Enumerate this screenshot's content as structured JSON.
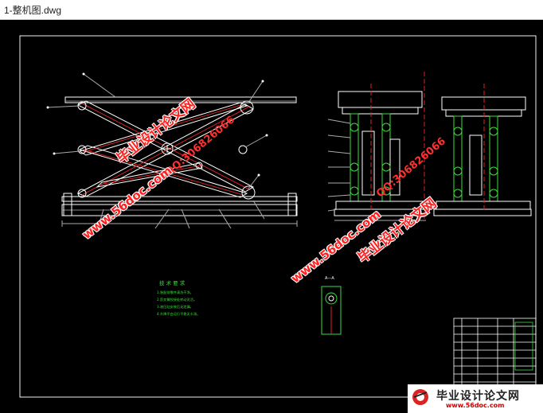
{
  "window": {
    "title": "1-整机图.dwg"
  },
  "drawing": {
    "notes_title": "技 术 要 求",
    "notes": [
      "1.装配前零件清洗干净。",
      "2.剪叉臂铰接处转动灵活。",
      "3.液压缸安装后无泄漏。",
      "4.升降平台运行平稳无卡滞。"
    ],
    "section_label": "A—A"
  },
  "watermarks": {
    "site_cn": "毕业设计论文网",
    "site_url": "www.56doc.com",
    "qq": "QQ:306826066"
  },
  "brand": {
    "name": "毕业设计论文网",
    "url": "www.56doc.com"
  }
}
